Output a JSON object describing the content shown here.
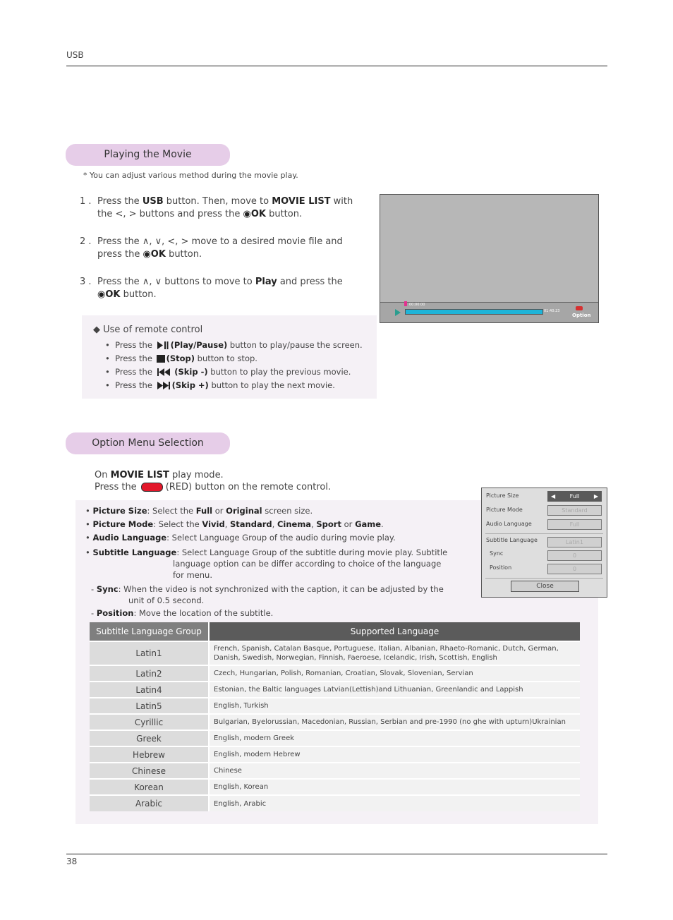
{
  "header": {
    "section": "USB"
  },
  "playing": {
    "title": "Playing the Movie",
    "note": "* You can adjust various method during the movie play.",
    "steps": [
      {
        "num": "1 .",
        "parts": [
          "Press the ",
          "USB",
          " button. Then, move to ",
          "MOVIE LIST",
          " with the <, > buttons and press the ",
          "◉OK",
          " button."
        ]
      },
      {
        "num": "2 .",
        "parts": [
          "Press the ∧, ∨, <, >  move to a desired movie file and press the ",
          "◉OK",
          " button."
        ]
      },
      {
        "num": "3 .",
        "parts": [
          "Press the ∧, ∨  buttons to move to ",
          "Play",
          " and press the ",
          "◉OK",
          " button."
        ]
      }
    ],
    "screen": {
      "time_current": "00:00:00",
      "time_total": "01:40:23",
      "progress_fraction": 1.0,
      "option_label": "Option"
    },
    "remote": {
      "title": "Use of remote control",
      "items": [
        {
          "prefix": "Press the",
          "name": "(Play/Pause)",
          "suffix": "button to play/pause the screen.",
          "icon": "play-pause-icon"
        },
        {
          "prefix": "Press the",
          "name": "(Stop)",
          "suffix": "button to stop.",
          "icon": "stop-icon"
        },
        {
          "prefix": "Press the",
          "name": "(Skip -)",
          "suffix": "button to play the previous movie.",
          "icon": "skip-back-icon"
        },
        {
          "prefix": "Press the",
          "name": "(Skip +)",
          "suffix": "button to play the next movie.",
          "icon": "skip-forward-icon"
        }
      ]
    }
  },
  "option": {
    "title": "Option Menu Selection",
    "line1_pre": "On ",
    "line1_bold": "MOVIE LIST",
    "line1_post": " play mode.",
    "line2_pre": "Press the",
    "line2_post": "(RED) button on the remote control.",
    "desc": {
      "picture_size": {
        "label": "Picture Size",
        "text1": ": Select the ",
        "b1": "Full",
        "text2": " or ",
        "b2": "Original",
        "text3": " screen size."
      },
      "picture_mode": {
        "label": "Picture Mode",
        "text1": ": Select the ",
        "b1": "Vivid",
        "b2": "Standard",
        "b3": "Cinema",
        "b4": "Sport",
        "b5": "Game"
      },
      "audio_language": {
        "label": "Audio Language",
        "text": ": Select Language Group of the audio during movie play."
      },
      "subtitle_language": {
        "label": "Subtitle Language",
        "text1": ": Select Language Group of the subtitle during movie play. Subtitle",
        "text2": "language option can be differ according to choice of the language",
        "text3": "for menu."
      },
      "sync": {
        "label": "Sync",
        "text1": ": When the video is not synchronized with the caption, it can be adjusted by the",
        "text2": "unit of 0.5 second."
      },
      "position": {
        "label": "Position",
        "text": ": Move the location of the subtitle."
      }
    },
    "menu": {
      "rows": [
        {
          "label": "Picture Size",
          "value": "Full"
        },
        {
          "label": "Picture Mode",
          "value": "Standard"
        },
        {
          "label": "Audio Language",
          "value": "Full"
        },
        {
          "label": "Subtitle Language",
          "value": "Latin1"
        },
        {
          "label": "Sync",
          "value": "0"
        },
        {
          "label": "Position",
          "value": "0"
        }
      ],
      "close": "Close"
    },
    "table": {
      "headers": [
        "Subtitle Language Group",
        "Supported Language"
      ],
      "rows": [
        [
          "Latin1",
          "French, Spanish, Catalan Basque, Portuguese, Italian, Albanian, Rhaeto-Romanic, Dutch, German, Danish, Swedish, Norwegian, Finnish, Faeroese, Icelandic, Irish, Scottish, English"
        ],
        [
          "Latin2",
          "Czech, Hungarian, Polish, Romanian, Croatian, Slovak, Slovenian, Servian"
        ],
        [
          "Latin4",
          "Estonian, the Baltic languages Latvian(Lettish)and Lithuanian, Greenlandic and Lappish"
        ],
        [
          "Latin5",
          "English, Turkish"
        ],
        [
          "Cyrillic",
          "Bulgarian, Byelorussian, Macedonian, Russian, Serbian and pre-1990 (no ghe with upturn)Ukrainian"
        ],
        [
          "Greek",
          "English, modern Greek"
        ],
        [
          "Hebrew",
          "English, modern Hebrew"
        ],
        [
          "Chinese",
          "Chinese"
        ],
        [
          "Korean",
          "English, Korean"
        ],
        [
          "Arabic",
          "English, Arabic"
        ]
      ]
    }
  },
  "footer": {
    "page": "38"
  }
}
